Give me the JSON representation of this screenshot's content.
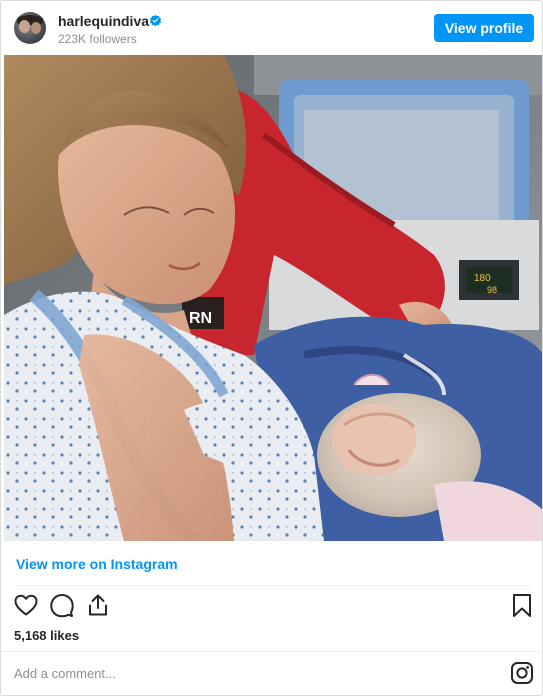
{
  "header": {
    "username": "harlequindiva",
    "followers": "223K followers",
    "view_profile_label": "View profile",
    "avatar_icon": "avatar",
    "verified_icon": "verified-badge-icon"
  },
  "post": {
    "photo_description_icon": "post-photo",
    "badge_text": "RN",
    "monitor_text_1": "180",
    "monitor_text_2": "98"
  },
  "links": {
    "view_more": "View more on Instagram"
  },
  "actions": {
    "like_icon": "heart-icon",
    "comment_icon": "comment-icon",
    "share_icon": "share-icon",
    "save_icon": "bookmark-icon"
  },
  "likes": "5,168 likes",
  "comment": {
    "placeholder": "Add a comment..."
  },
  "colors": {
    "accent": "#0095f6",
    "text": "#262626",
    "muted": "#8e8e8e"
  }
}
